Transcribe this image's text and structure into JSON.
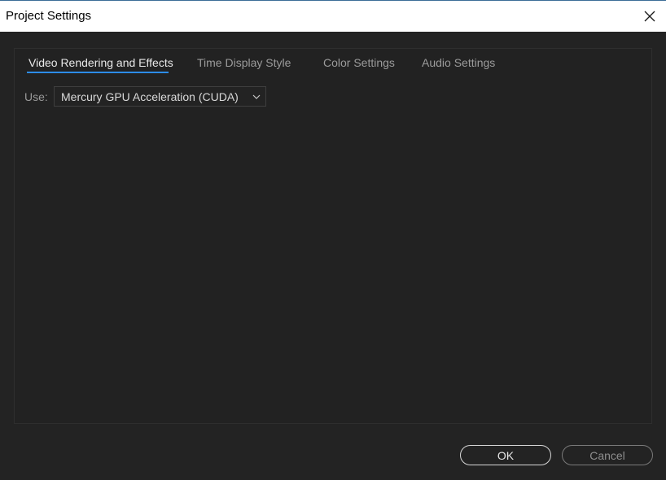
{
  "window": {
    "title": "Project Settings",
    "close_icon": "close-icon"
  },
  "tabs": [
    {
      "label": "Video Rendering and Effects",
      "active": true
    },
    {
      "label": "Time Display Style",
      "active": false
    },
    {
      "label": "Color Settings",
      "active": false
    },
    {
      "label": "Audio Settings",
      "active": false
    }
  ],
  "renderer": {
    "use_label": "Use:",
    "selected": "Mercury GPU Acceleration (CUDA)",
    "chevron_icon": "chevron-down-icon"
  },
  "buttons": {
    "ok": "OK",
    "cancel": "Cancel"
  },
  "colors": {
    "background": "#232323",
    "accent": "#2d8ceb",
    "titlebar": "#ffffff"
  }
}
